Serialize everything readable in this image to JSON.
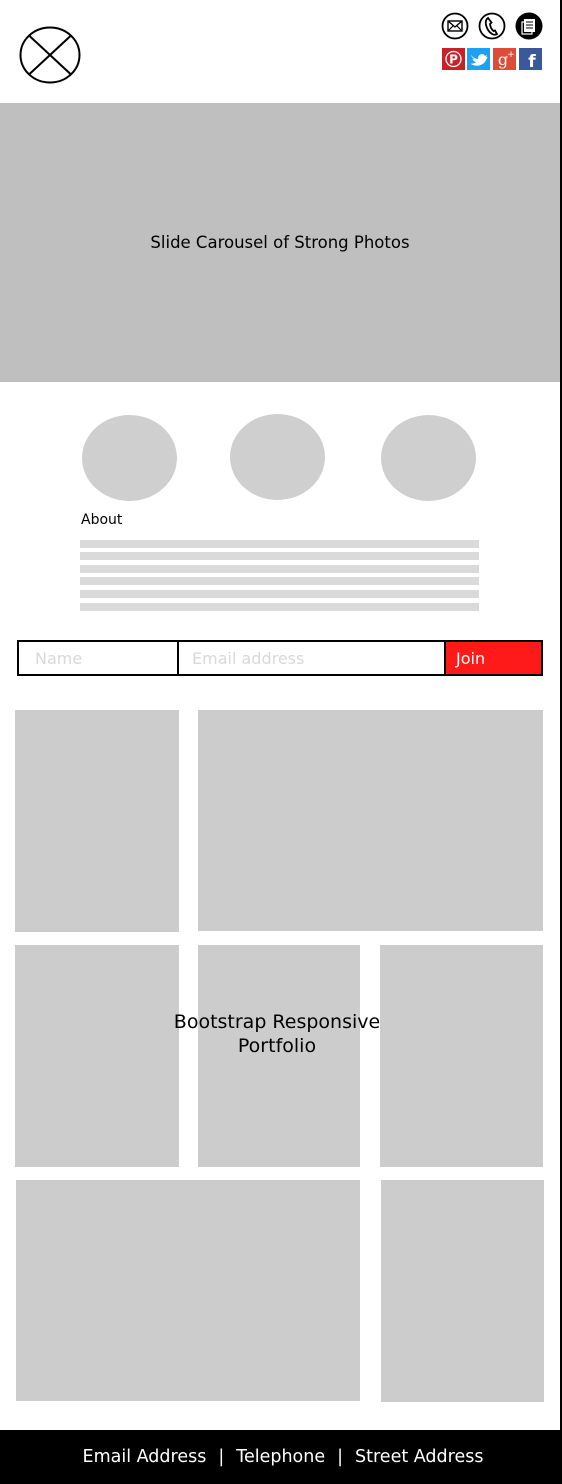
{
  "header": {
    "logo_icon": "placeholder-x-logo-icon",
    "contact_icons": [
      "email-icon",
      "phone-icon",
      "document-icon"
    ],
    "social_icons": [
      {
        "name": "pinterest-icon",
        "glyph": "P",
        "color": "#cb2027"
      },
      {
        "name": "twitter-icon",
        "glyph": "t",
        "color": "#1da1f2"
      },
      {
        "name": "google-plus-icon",
        "glyph": "g+",
        "color": "#dd4b39"
      },
      {
        "name": "facebook-icon",
        "glyph": "f",
        "color": "#3b5998"
      }
    ]
  },
  "carousel": {
    "label": "Slide Carousel of Strong Photos"
  },
  "about": {
    "heading": "About"
  },
  "signup": {
    "name_placeholder": "Name",
    "email_placeholder": "Email address",
    "join_label": "Join"
  },
  "portfolio": {
    "label_line1": "Bootstrap Responsive",
    "label_line2": "Portfolio"
  },
  "footer": {
    "email": "Email Address",
    "telephone": "Telephone",
    "street": "Street Address",
    "separator": "|"
  },
  "colors": {
    "accent": "#ff1a1a",
    "placeholder_gray": "#cccccc",
    "carousel_gray": "#bfbfbf",
    "footer_bg": "#000000"
  }
}
